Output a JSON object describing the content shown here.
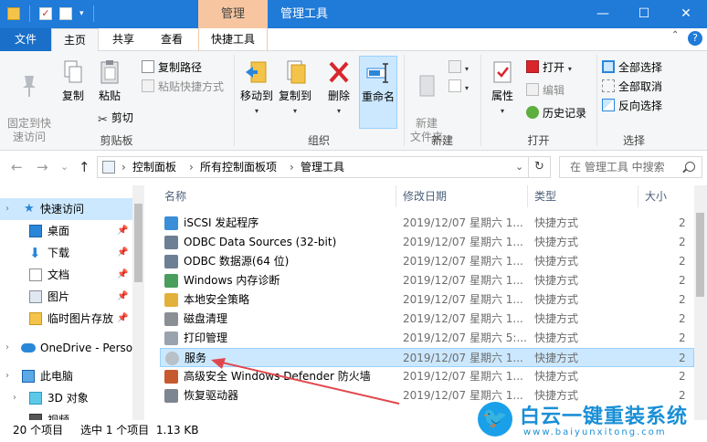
{
  "window": {
    "title": "管理工具",
    "context_tab": "管理",
    "min_glyph": "—",
    "max_glyph": "☐",
    "close_glyph": "✕"
  },
  "quick_access_toolbar": {
    "check_glyph": "✓",
    "dropdown_glyph": "▾"
  },
  "tabs": [
    {
      "label": "文件"
    },
    {
      "label": "主页"
    },
    {
      "label": "共享"
    },
    {
      "label": "查看"
    },
    {
      "label": "快捷工具"
    }
  ],
  "ribbon": {
    "collapse_glyph": "⌃",
    "help_glyph": "?",
    "clipboard": {
      "label": "剪贴板",
      "pin": "固定到快\n速访问",
      "copy": "复制",
      "paste": "粘贴",
      "copy_path": "复制路径",
      "paste_shortcut": "粘贴快捷方式",
      "cut": "剪切"
    },
    "organize": {
      "label": "组织",
      "move_to": "移动到",
      "copy_to": "复制到",
      "delete": "删除",
      "rename": "重命名"
    },
    "new": {
      "label": "新建",
      "new_folder": "新建\n文件夹"
    },
    "open": {
      "label": "打开",
      "properties": "属性",
      "open": "打开",
      "edit": "编辑",
      "history": "历史记录"
    },
    "select": {
      "label": "选择",
      "select_all": "全部选择",
      "select_none": "全部取消",
      "invert": "反向选择"
    }
  },
  "address": {
    "back_glyph": "←",
    "forward_glyph": "→",
    "recent_glyph": "⌄",
    "up_glyph": "↑",
    "sep_glyph": "›",
    "dropdown_glyph": "⌄",
    "refresh_glyph": "↻",
    "crumbs": [
      "控制面板",
      "所有控制面板项",
      "管理工具"
    ],
    "search_placeholder": "在 管理工具 中搜索"
  },
  "nav": {
    "expand_glyph": "›",
    "pin_glyph": "📌",
    "quick_access": "快速访问",
    "items": [
      {
        "label": "桌面"
      },
      {
        "label": "下载"
      },
      {
        "label": "文档"
      },
      {
        "label": "图片"
      },
      {
        "label": "临时图片存放"
      }
    ],
    "onedrive": "OneDrive - Perso",
    "this_pc": "此电脑",
    "objects3d": "3D 对象",
    "video": "视频"
  },
  "list": {
    "sort_glyph": "⌃",
    "columns": {
      "name": "名称",
      "date": "修改日期",
      "type": "类型",
      "size": "大小"
    },
    "rows": [
      {
        "name": "iSCSI 发起程序",
        "date": "2019/12/07 星期六 1...",
        "type": "快捷方式",
        "size": "2"
      },
      {
        "name": "ODBC Data Sources (32-bit)",
        "date": "2019/12/07 星期六 1...",
        "type": "快捷方式",
        "size": "2"
      },
      {
        "name": "ODBC 数据源(64 位)",
        "date": "2019/12/07 星期六 1...",
        "type": "快捷方式",
        "size": "2"
      },
      {
        "name": "Windows 内存诊断",
        "date": "2019/12/07 星期六 1...",
        "type": "快捷方式",
        "size": "2"
      },
      {
        "name": "本地安全策略",
        "date": "2019/12/07 星期六 1...",
        "type": "快捷方式",
        "size": "2"
      },
      {
        "name": "磁盘清理",
        "date": "2019/12/07 星期六 1...",
        "type": "快捷方式",
        "size": "2"
      },
      {
        "name": "打印管理",
        "date": "2019/12/07 星期六 5:...",
        "type": "快捷方式",
        "size": "2"
      },
      {
        "name": "服务",
        "date": "2019/12/07 星期六 1...",
        "type": "快捷方式",
        "size": "2"
      },
      {
        "name": "高级安全 Windows Defender 防火墙",
        "date": "2019/12/07 星期六 1...",
        "type": "快捷方式",
        "size": "2"
      },
      {
        "name": "恢复驱动器",
        "date": "2019/12/07 星期六 1...",
        "type": "快捷方式",
        "size": "2"
      }
    ]
  },
  "status": {
    "count": "20 个项目",
    "selected": "选中 1 个项目  1.13 KB"
  },
  "watermark": {
    "title": "白云一键重装系统",
    "url": "www.baiyunxitong.com"
  },
  "colors": {
    "titlebar": "#1f7ad8",
    "file_tab": "#1a6fc9",
    "context_tab": "#f7c6a0",
    "selection": "#cce8ff",
    "annotation_arrow": "#e0474c"
  }
}
